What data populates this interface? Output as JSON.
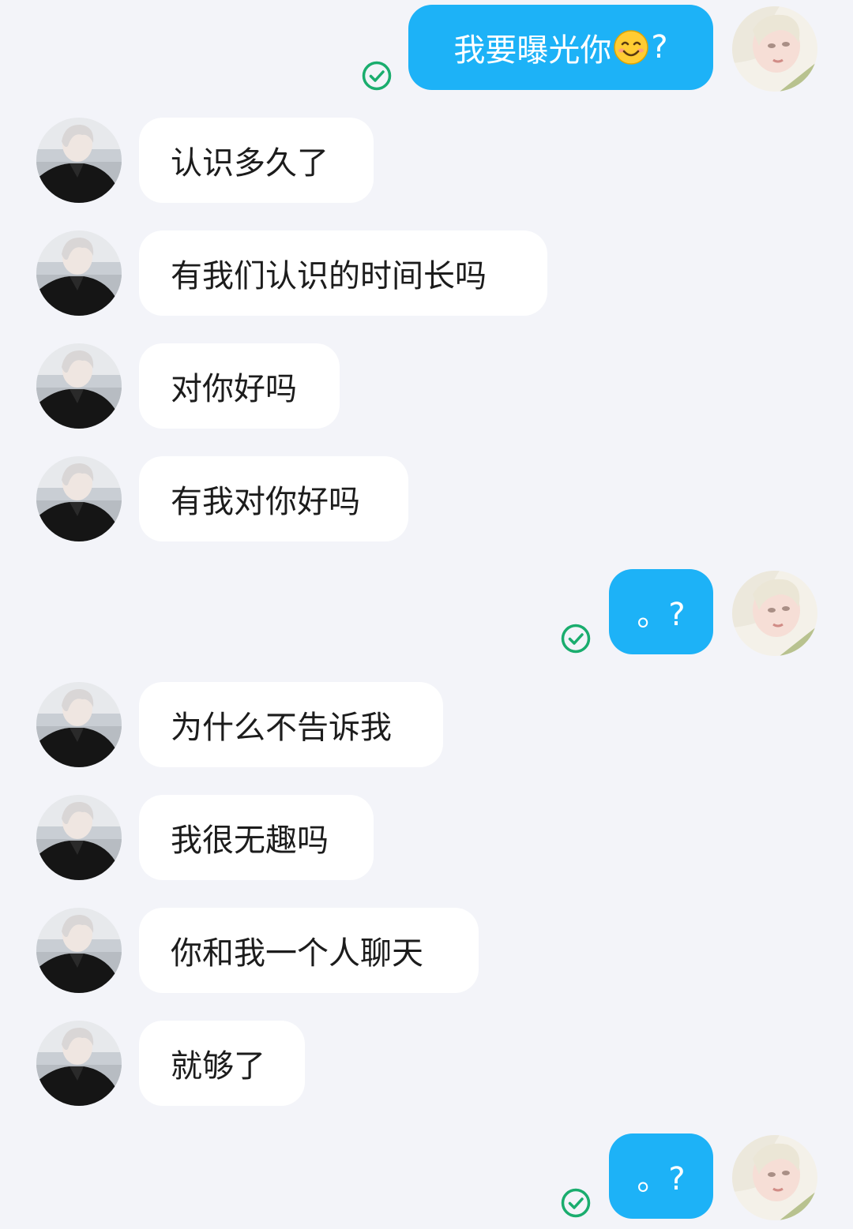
{
  "messages": [
    {
      "side": "out",
      "text": "我要曝光你",
      "emoji": "smiling-face-emoji",
      "suffix": "?"
    },
    {
      "side": "in",
      "text": "认识多久了"
    },
    {
      "side": "in",
      "text": "有我们认识的时间长吗"
    },
    {
      "side": "in",
      "text": "对你好吗"
    },
    {
      "side": "in",
      "text": "有我对你好吗"
    },
    {
      "side": "out",
      "text": "。?"
    },
    {
      "side": "in",
      "text": "为什么不告诉我"
    },
    {
      "side": "in",
      "text": "我很无趣吗"
    },
    {
      "side": "in",
      "text": "你和我一个人聊天"
    },
    {
      "side": "in",
      "text": "就够了"
    },
    {
      "side": "out",
      "text": "。?"
    }
  ],
  "colors": {
    "background": "#f3f4f9",
    "outgoing_bubble": "#1db2f7",
    "incoming_bubble": "#ffffff",
    "read_check": "#1aad6e"
  },
  "icons": {
    "read_status": "read-check-icon",
    "sender_avatar": "contact-avatar",
    "self_avatar": "self-avatar"
  }
}
